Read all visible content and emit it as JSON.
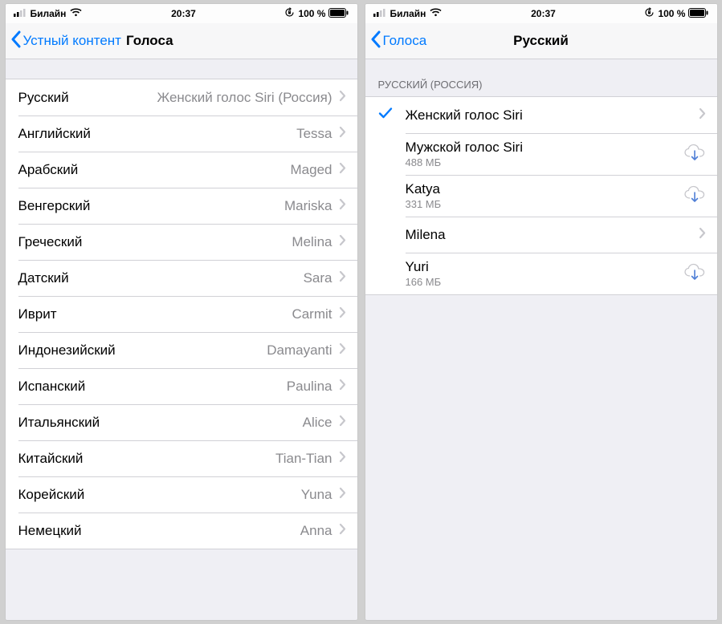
{
  "status": {
    "carrier": "Билайн",
    "time": "20:37",
    "battery_text": "100 %"
  },
  "left": {
    "back_label": "Устный контент",
    "title": "Голоса",
    "rows": [
      {
        "lang": "Русский",
        "voice": "Женский голос Siri (Россия)"
      },
      {
        "lang": "Английский",
        "voice": "Tessa"
      },
      {
        "lang": "Арабский",
        "voice": "Maged"
      },
      {
        "lang": "Венгерский",
        "voice": "Mariska"
      },
      {
        "lang": "Греческий",
        "voice": "Melina"
      },
      {
        "lang": "Датский",
        "voice": "Sara"
      },
      {
        "lang": "Иврит",
        "voice": "Carmit"
      },
      {
        "lang": "Индонезийский",
        "voice": "Damayanti"
      },
      {
        "lang": "Испанский",
        "voice": "Paulina"
      },
      {
        "lang": "Итальянский",
        "voice": "Alice"
      },
      {
        "lang": "Китайский",
        "voice": "Tian-Tian"
      },
      {
        "lang": "Корейский",
        "voice": "Yuna"
      },
      {
        "lang": "Немецкий",
        "voice": "Anna"
      }
    ]
  },
  "right": {
    "back_label": "Голоса",
    "title": "Русский",
    "section_header": "РУССКИЙ (РОССИЯ)",
    "rows": [
      {
        "name": "Женский голос Siri",
        "size": null,
        "selected": true,
        "accessory": "chevron"
      },
      {
        "name": "Мужской голос Siri",
        "size": "488 МБ",
        "selected": false,
        "accessory": "download"
      },
      {
        "name": "Katya",
        "size": "331 МБ",
        "selected": false,
        "accessory": "download"
      },
      {
        "name": "Milena",
        "size": null,
        "selected": false,
        "accessory": "chevron"
      },
      {
        "name": "Yuri",
        "size": "166 МБ",
        "selected": false,
        "accessory": "download"
      }
    ]
  }
}
